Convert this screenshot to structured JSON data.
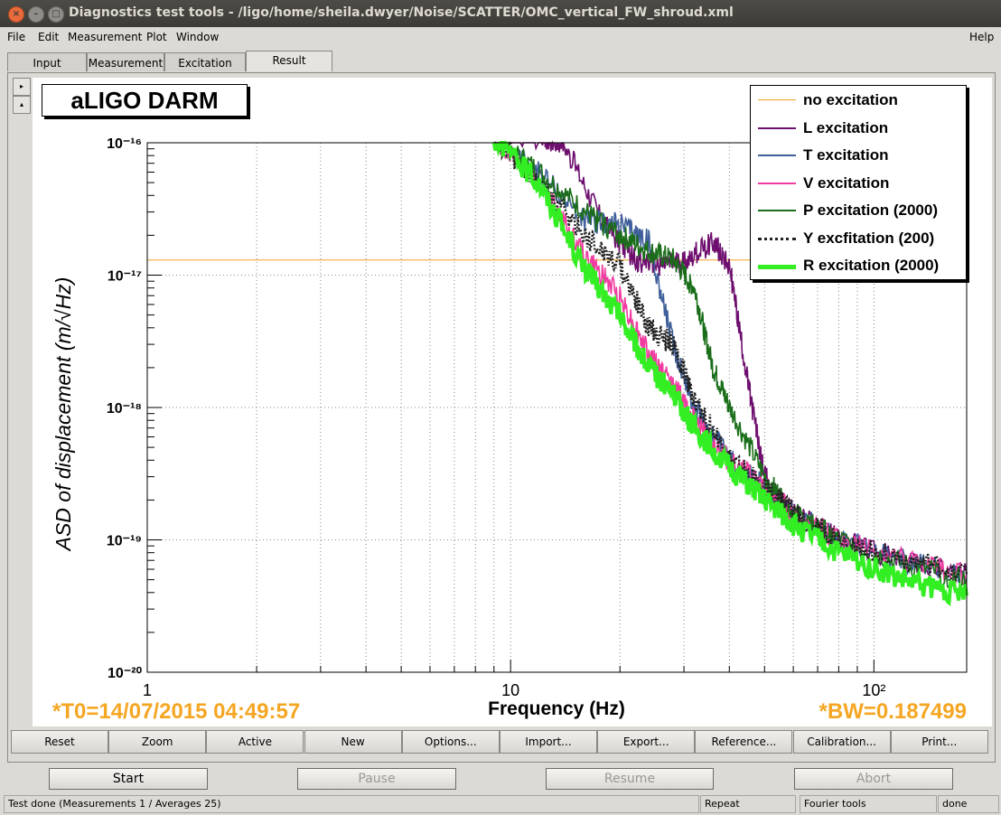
{
  "window": {
    "title": "Diagnostics test tools - /ligo/home/sheila.dwyer/Noise/SCATTER/OMC_vertical_FW_shroud.xml"
  },
  "menu": {
    "file": "File",
    "edit": "Edit",
    "measurement": "Measurement",
    "plot": "Plot",
    "window": "Window",
    "help": "Help"
  },
  "tabs": [
    {
      "label": "Input"
    },
    {
      "label": "Measurement"
    },
    {
      "label": "Excitation"
    },
    {
      "label": "Result"
    }
  ],
  "plot": {
    "panel_title": "aLIGO DARM",
    "t0": "*T0=14/07/2015 04:49:57",
    "bw": "*BW=0.187499"
  },
  "legend": [
    {
      "label": "no excitation",
      "color": "#f0a020"
    },
    {
      "label": "L excitation",
      "color": "#6e0e6e"
    },
    {
      "label": "T excitation",
      "color": "#3f5f9a"
    },
    {
      "label": "V excitation",
      "color": "#f03ca0"
    },
    {
      "label": "P excitation (2000)",
      "color": "#1a6e1a"
    },
    {
      "label": "Y excfitation (200)",
      "color": "#222222"
    },
    {
      "label": "R excitation (2000)",
      "color": "#33ee22"
    }
  ],
  "chart_data": {
    "type": "line",
    "title": "aLIGO DARM",
    "xlabel": "Frequency (Hz)",
    "ylabel": "ASD of displacement (m/√Hz)",
    "x_scale": "log",
    "y_scale": "log",
    "xlim": [
      1,
      180
    ],
    "ylim": [
      1e-20,
      1e-16
    ],
    "x_ticks": [
      "1",
      "10",
      "10²"
    ],
    "y_ticks": [
      "10⁻¹⁶",
      "10⁻¹⁷",
      "10⁻¹⁸",
      "10⁻¹⁹",
      "10⁻²⁰"
    ],
    "grid": true,
    "legend_position": "top-right",
    "series": [
      {
        "name": "no excitation",
        "color": "#f0a020",
        "x": [
          1,
          180
        ],
        "y": [
          1.3e-17,
          1.3e-17
        ]
      },
      {
        "name": "L excitation",
        "color": "#6e0e6e",
        "x": [
          9,
          12,
          14,
          18,
          22,
          26,
          30,
          36,
          40,
          45,
          50,
          60,
          80,
          120,
          180
        ],
        "y": [
          1.2e-16,
          1.1e-16,
          1e-16,
          2.5e-17,
          1.3e-17,
          1.2e-17,
          1.25e-17,
          1.8e-17,
          1.2e-17,
          1.5e-18,
          3e-19,
          1.6e-19,
          1e-19,
          7e-20,
          5.5e-20
        ]
      },
      {
        "name": "T excitation",
        "color": "#3f5f9a",
        "x": [
          9,
          12,
          16,
          20,
          24,
          28,
          32,
          40,
          50,
          60,
          80,
          120,
          180
        ],
        "y": [
          1.1e-16,
          6e-17,
          2.6e-17,
          2.4e-17,
          1.8e-17,
          3e-18,
          1e-18,
          4e-19,
          2.5e-19,
          1.6e-19,
          1e-19,
          7e-20,
          5.5e-20
        ]
      },
      {
        "name": "V excitation",
        "color": "#f03ca0",
        "x": [
          9,
          12,
          16,
          20,
          24,
          28,
          32,
          40,
          50,
          60,
          80,
          120,
          180
        ],
        "y": [
          1.1e-16,
          5e-17,
          1.4e-17,
          7e-18,
          2.5e-18,
          1.5e-18,
          8e-19,
          4e-19,
          2.5e-19,
          1.6e-19,
          1e-19,
          7e-20,
          5.5e-20
        ]
      },
      {
        "name": "P excitation (2000)",
        "color": "#1a6e1a",
        "x": [
          9,
          12,
          16,
          20,
          24,
          28,
          32,
          36,
          40,
          50,
          60,
          80,
          120,
          180
        ],
        "y": [
          1.1e-16,
          6e-17,
          3e-17,
          2e-17,
          1.5e-17,
          1.3e-17,
          8e-18,
          2e-18,
          1e-18,
          3e-19,
          1.6e-19,
          1e-19,
          6.5e-20,
          5e-20
        ]
      },
      {
        "name": "Y excfitation (200)",
        "color": "#222222",
        "x": [
          9,
          12,
          16,
          20,
          24,
          28,
          32,
          40,
          50,
          60,
          80,
          120,
          180
        ],
        "y": [
          1.1e-16,
          5e-17,
          2e-17,
          1.2e-17,
          4e-18,
          3e-18,
          1.2e-18,
          4e-19,
          2.5e-19,
          1.6e-19,
          1e-19,
          7e-20,
          5.5e-20
        ]
      },
      {
        "name": "R excitation (2000)",
        "color": "#33ee22",
        "x": [
          9,
          12,
          16,
          20,
          24,
          28,
          32,
          40,
          50,
          60,
          80,
          120,
          180
        ],
        "y": [
          1.1e-16,
          5e-17,
          1.1e-17,
          5e-18,
          2e-18,
          1.3e-18,
          7e-19,
          3.5e-19,
          2e-19,
          1.3e-19,
          8e-20,
          5e-20,
          3.8e-20
        ]
      }
    ]
  },
  "plot_buttons": [
    "Reset",
    "Zoom",
    "Active",
    "New",
    "Options...",
    "Import...",
    "Export...",
    "Reference...",
    "Calibration...",
    "Print..."
  ],
  "controls": {
    "start": "Start",
    "pause": "Pause",
    "resume": "Resume",
    "abort": "Abort"
  },
  "status": {
    "message": "Test done (Measurements 1 / Averages 25)",
    "mode": "Repeat",
    "tool": "Fourier tools",
    "state": "done"
  }
}
